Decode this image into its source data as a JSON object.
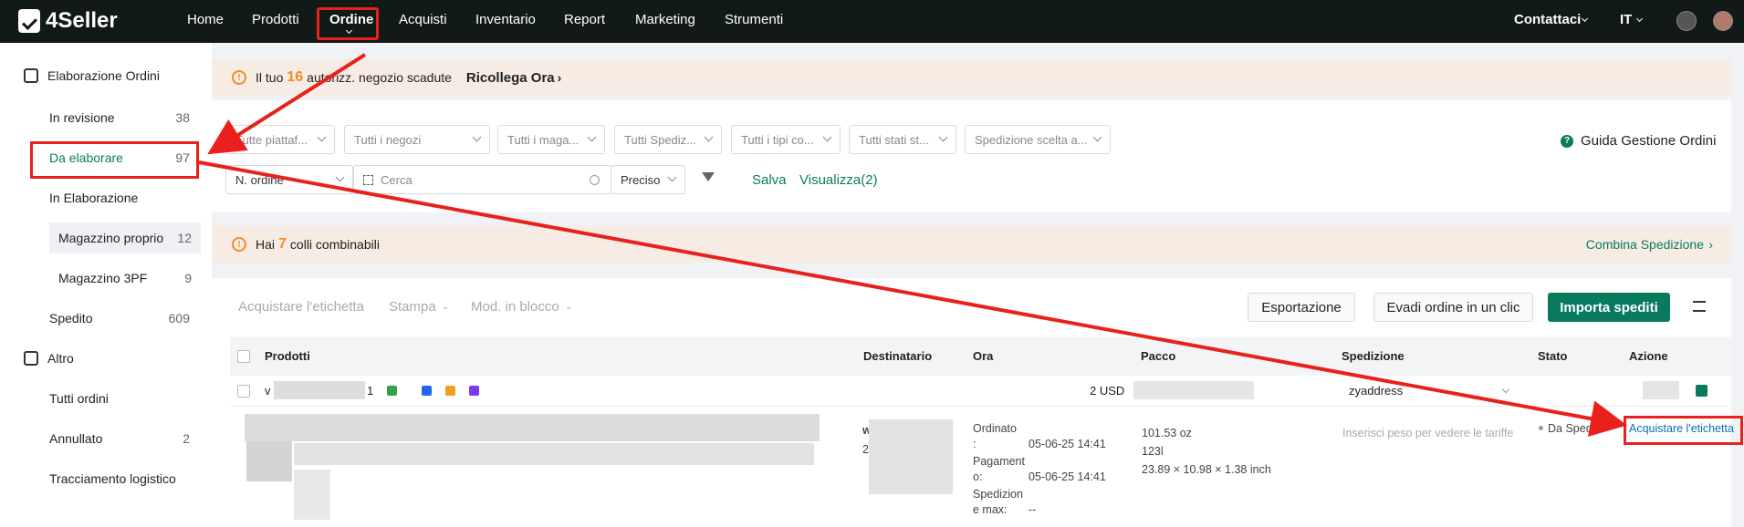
{
  "app": {
    "logo_text": "4Seller"
  },
  "nav": {
    "items": [
      "Home",
      "Prodotti",
      "Ordine",
      "Acquisti",
      "Inventario",
      "Report",
      "Marketing",
      "Strumenti"
    ],
    "active": "Ordine",
    "contact": "Contattaci",
    "language": "IT"
  },
  "sidebar": {
    "group1": "Elaborazione Ordini",
    "items": [
      {
        "label": "In revisione",
        "count": "38"
      },
      {
        "label": "Da elaborare",
        "count": "97"
      },
      {
        "label": "In Elaborazione",
        "count": ""
      },
      {
        "label": "Magazzino proprio",
        "count": "12"
      },
      {
        "label": "Magazzino 3PF",
        "count": "9"
      },
      {
        "label": "Spedito",
        "count": "609"
      }
    ],
    "group2": "Altro",
    "items2": [
      {
        "label": "Tutti ordini",
        "count": ""
      },
      {
        "label": "Annullato",
        "count": "2"
      },
      {
        "label": "Tracciamento logistico",
        "count": ""
      }
    ]
  },
  "banner1": {
    "pre": "Il tuo",
    "num": "16",
    "post": "autorizz. negozio scadute",
    "link": "Ricollega Ora"
  },
  "filters": {
    "dropdowns": [
      "Tutte piattaf...",
      "Tutti i negozi",
      "Tutti i maga...",
      "Tutti Spediz...",
      "Tutti i tipi co...",
      "Tutti stati st...",
      "Spedizione scelta a..."
    ],
    "guide": "Guida Gestione Ordini",
    "search_type": "N. ordine",
    "search_placeholder": "Cerca",
    "match": "Preciso",
    "save": "Salva",
    "view": "Visualizza(2)"
  },
  "banner2": {
    "pre": "Hai",
    "num": "7",
    "post": "colli combinabili",
    "link": "Combina Spedizione"
  },
  "toolbar": {
    "buy_label": "Acquistare l'etichetta",
    "print": "Stampa",
    "bulk": "Mod. in blocco",
    "export": "Esportazione",
    "one_click": "Evadi ordine in un clic",
    "import": "Importa spediti"
  },
  "table": {
    "headers": [
      "Prodotti",
      "Destinatario",
      "Ora",
      "Pacco",
      "Spedizione",
      "Stato",
      "Azione"
    ],
    "row_header": {
      "partial_left": "v",
      "partial_1": "1",
      "amount": "2 USD",
      "ship_address": "zyaddress"
    },
    "row": {
      "ordered_label": "Ordinato",
      "ordered_colon": ":",
      "ordered_date": "05-06-25 14:41",
      "payment_label1": "Pagament",
      "payment_label2": "o:",
      "payment_date": "05-06-25 14:41",
      "ship_label1": "Spedizion",
      "ship_label2": "e max:",
      "ship_value": "--",
      "weight": "101.53 oz",
      "volume": "123l",
      "dims": "23.89 × 10.98 × 1.38 inch",
      "ship_hint": "Inserisci peso per vedere le tariffe",
      "status": "Da Spedire",
      "action": "Acquistare l'etichetta",
      "more": "...",
      "dest_initial": "w",
      "dest_2": "2"
    }
  },
  "colors": {
    "brand": "#0a7a5f",
    "nav_bg": "#111a16",
    "warning": "#f08c2a",
    "annotation": "#e8211c"
  }
}
